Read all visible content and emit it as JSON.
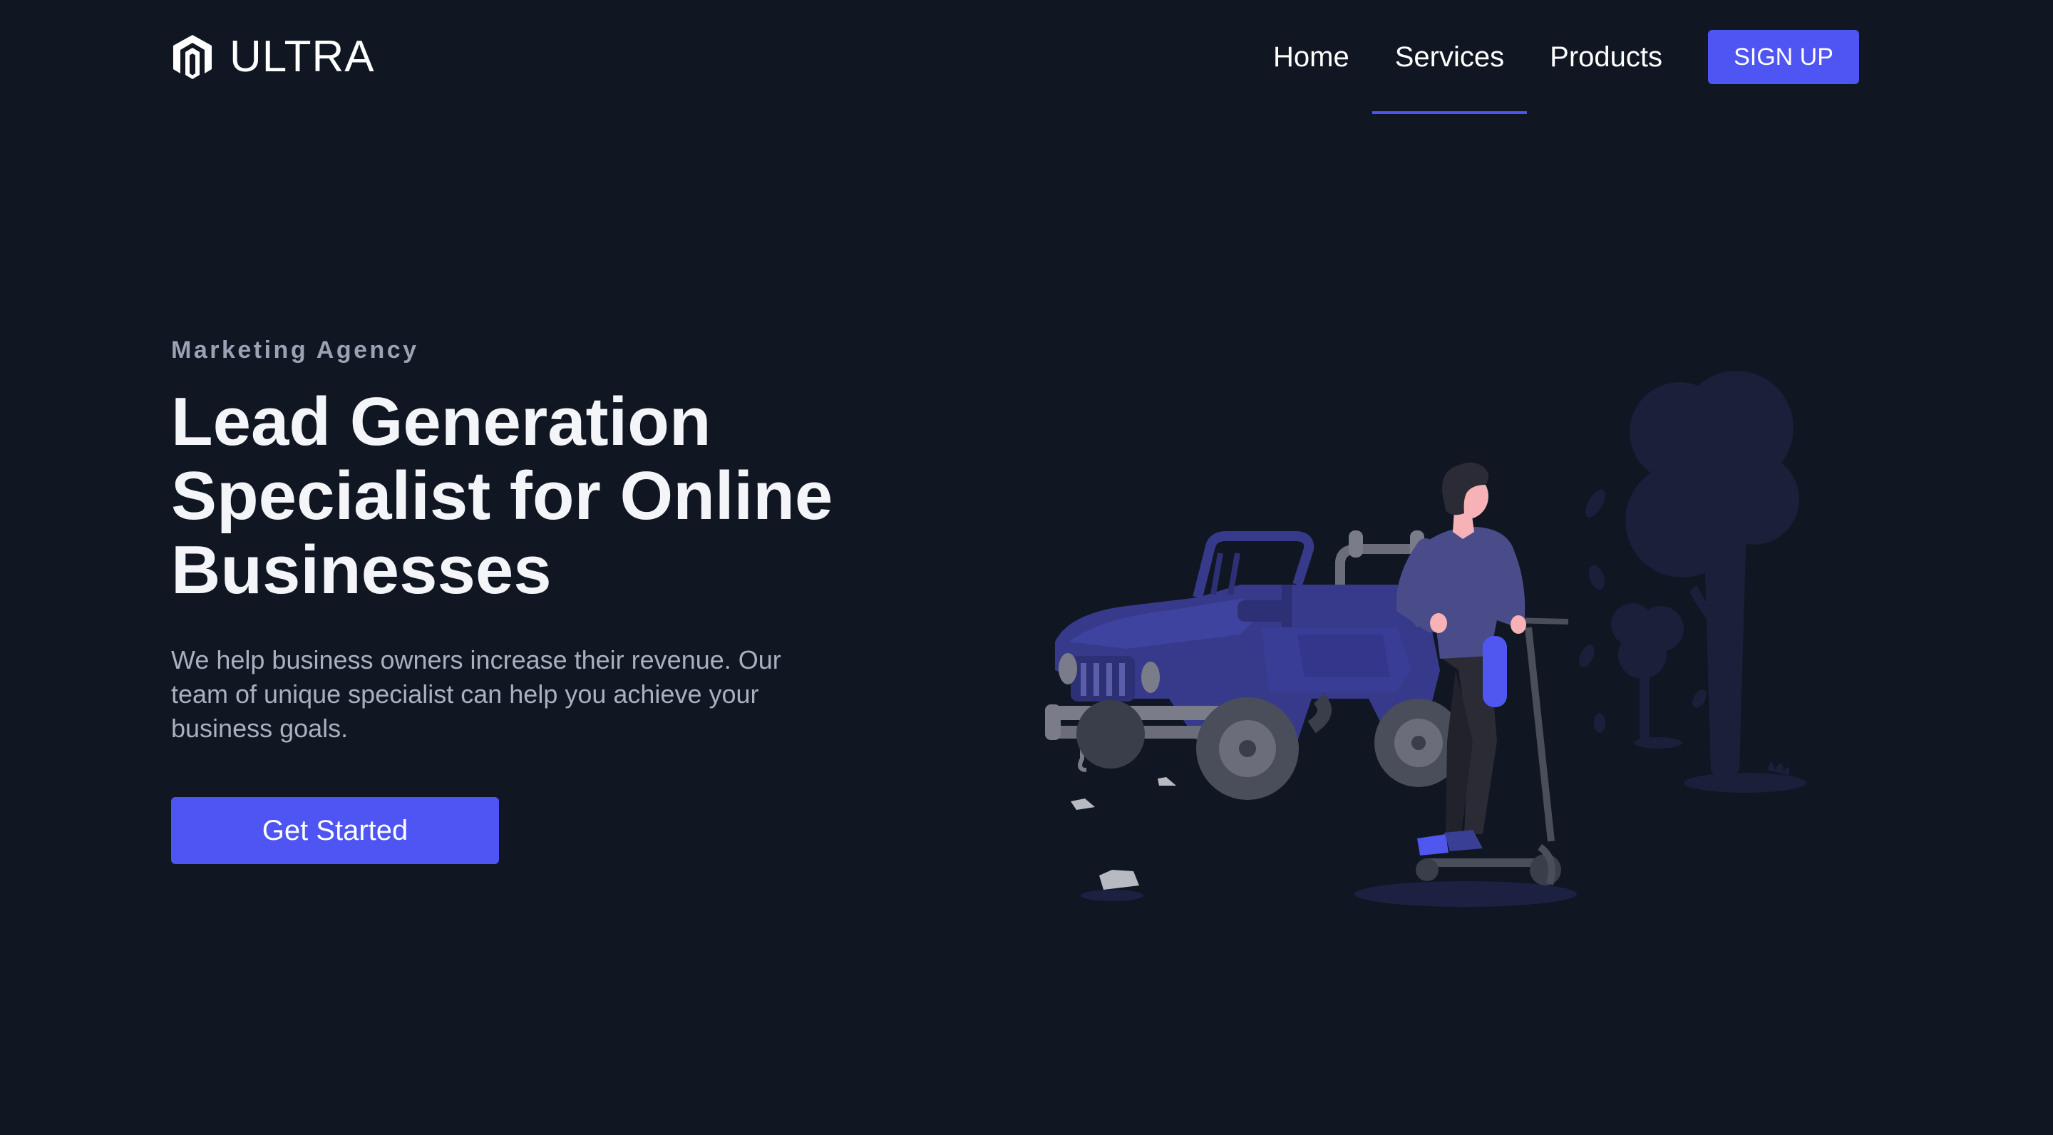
{
  "header": {
    "logo_text": "ULTRA",
    "nav": [
      {
        "label": "Home",
        "active": false
      },
      {
        "label": "Services",
        "active": true
      },
      {
        "label": "Products",
        "active": false
      }
    ],
    "signup_label": "SIGN UP"
  },
  "hero": {
    "eyebrow": "Marketing Agency",
    "headline": "Lead Generation Specialist for Online Businesses",
    "subtext": "We help business owners increase their revenue. Our team of unique specialist can help you achieve your business goals.",
    "cta_label": "Get Started"
  },
  "colors": {
    "background": "#101622",
    "accent": "#4e55f2",
    "headline": "#f4f5f8",
    "eyebrow": "#9aa2b4",
    "body_text": "#a9b0be"
  },
  "icons": {
    "logo": "hexagon-m-logo-icon",
    "illustration": "person-on-scooter-with-jeep-illustration"
  }
}
